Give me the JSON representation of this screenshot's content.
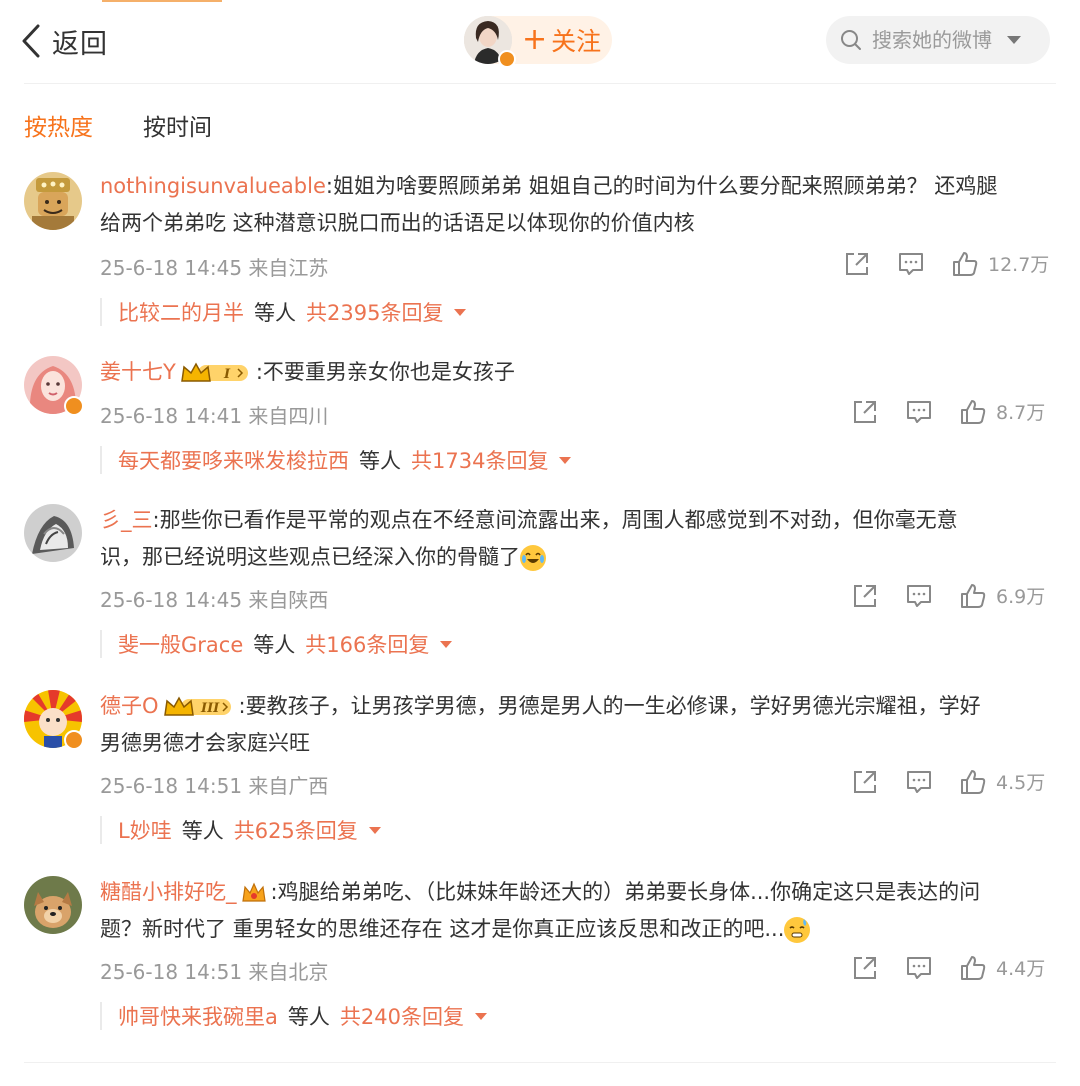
{
  "header": {
    "back_label": "返回",
    "follow_label": "关注",
    "follow_plus": "+",
    "search_placeholder": "搜索她的微博"
  },
  "sort_tabs": [
    {
      "label": "按热度",
      "active": true
    },
    {
      "label": "按时间",
      "active": false
    }
  ],
  "colors": {
    "accent": "#f7731c",
    "username": "#eb7350",
    "meta": "#999999"
  },
  "comments": [
    {
      "user": "nothingisunvalueable",
      "text_line1": ":姐姐为啥要照顾弟弟 姐姐自己的时间为什么要分配来照顾弟弟？  还鸡腿",
      "text_line2": "给两个弟弟吃 这种潜意识脱口而出的话语足以体现你的价值内核",
      "time": "25-6-18 14:45 来自江苏",
      "likes": "12.7万",
      "reply_user": "比较二的月半",
      "reply_etc": "等人",
      "reply_count": "共2395条回复"
    },
    {
      "user": "姜十七Y",
      "badge": "I",
      "text": ":不要重男亲女你也是女孩子",
      "time": "25-6-18 14:41 来自四川",
      "likes": "8.7万",
      "reply_user": "每天都要哆来咪发梭拉西",
      "reply_etc": "等人",
      "reply_count": "共1734条回复"
    },
    {
      "user": "彡_三",
      "text_line1": ":那些你已看作是平常的观点在不经意间流露出来，周围人都感觉到不对劲，但你毫无意",
      "text_line2": "识，那已经说明这些观点已经深入你的骨髓了",
      "emoji": "laugh-cry-emoji",
      "time": "25-6-18 14:45 来自陕西",
      "likes": "6.9万",
      "reply_user": "斐一般Grace",
      "reply_etc": "等人",
      "reply_count": "共166条回复"
    },
    {
      "user": "德子O",
      "badge": "III",
      "text_line1": ":要教孩子，让男孩学男德，男德是男人的一生必修课，学好男德光宗耀祖，学好",
      "text_line2": "男德男德才会家庭兴旺",
      "time": "25-6-18 14:51 来自广西",
      "likes": "4.5万",
      "reply_user": "L妙哇",
      "reply_etc": "等人",
      "reply_count": "共625条回复"
    },
    {
      "user": "糖醋小排好吃_",
      "text_line1": ":鸡腿给弟弟吃、（比妹妹年龄还大的）弟弟要长身体...你确定这只是表达的问",
      "text_line2": "题？新时代了 重男轻女的思维还存在 这才是你真正应该反思和改正的吧...",
      "emoji": "sweat-emoji",
      "time": "25-6-18 14:51 来自北京",
      "likes": "4.4万",
      "reply_user": "帅哥快来我碗里a",
      "reply_etc": "等人",
      "reply_count": "共240条回复"
    }
  ]
}
